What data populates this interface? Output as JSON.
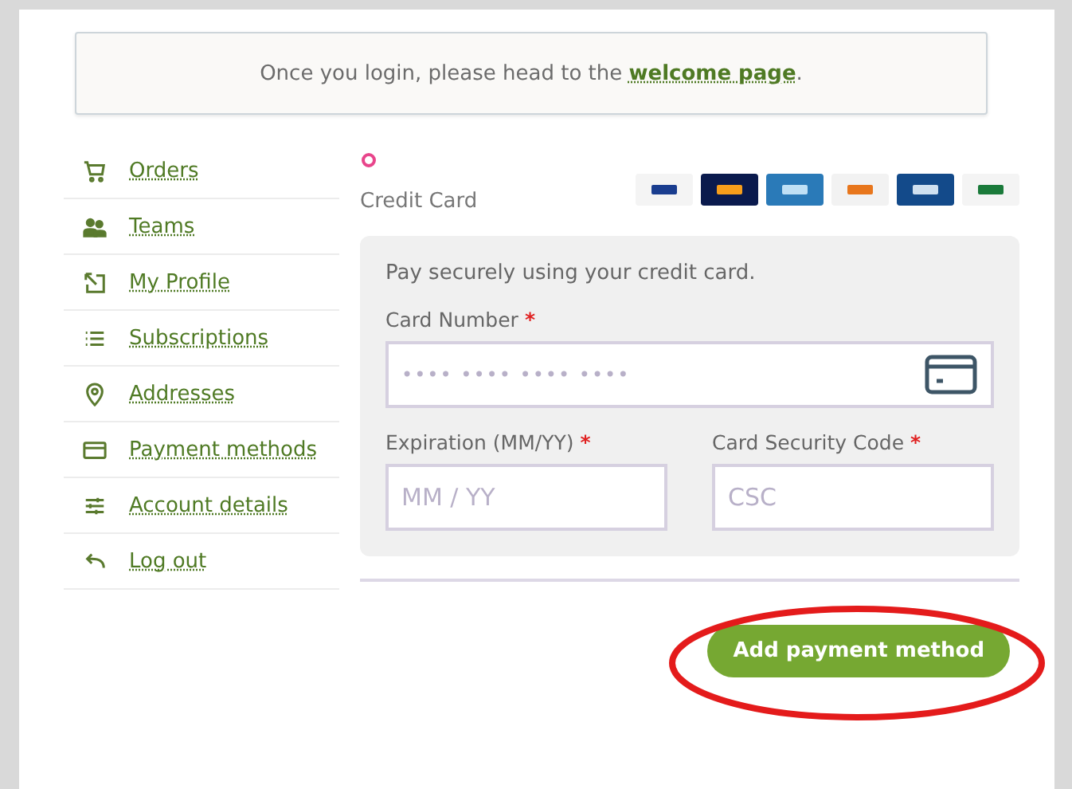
{
  "notice": {
    "text": "Once you login, please head to the ",
    "link": "welcome page",
    "end": "."
  },
  "sidebar": {
    "items": [
      {
        "label": "Orders"
      },
      {
        "label": "Teams"
      },
      {
        "label": "My Profile"
      },
      {
        "label": "Subscriptions"
      },
      {
        "label": "Addresses"
      },
      {
        "label": "Payment methods"
      },
      {
        "label": "Account details"
      },
      {
        "label": "Log out"
      }
    ]
  },
  "payment_option": {
    "label": "Credit Card",
    "selected": true,
    "description": "Pay securely using your credit card.",
    "fields": [
      {
        "label": "Card Number",
        "required_mark": "*",
        "placeholder": "•••• •••• •••• ••••"
      },
      {
        "label": "Expiration (MM/YY)",
        "required_mark": "*",
        "placeholder": "MM / YY"
      },
      {
        "label": "Card Security Code",
        "required_mark": "*",
        "placeholder": "CSC"
      }
    ]
  },
  "submit_button": "Add payment method"
}
